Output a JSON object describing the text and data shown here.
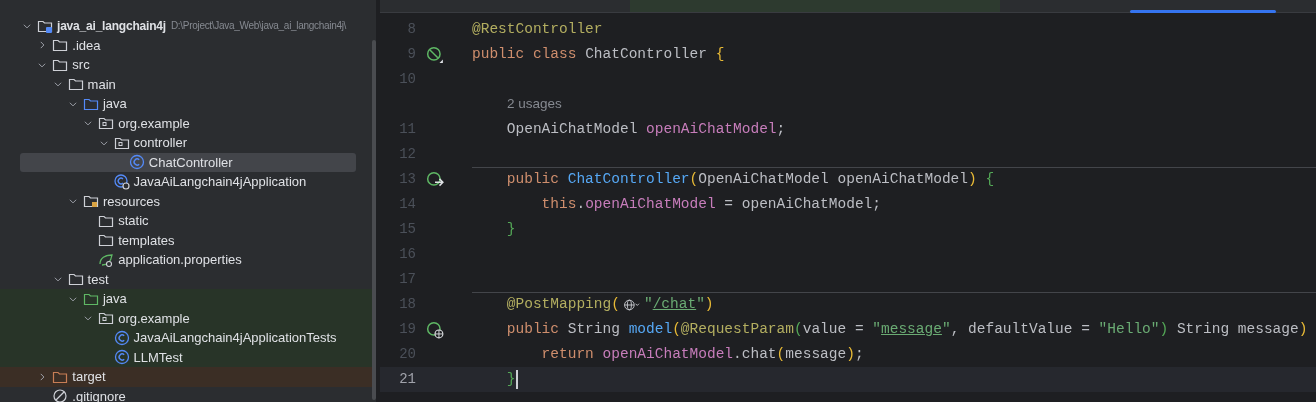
{
  "project_tree": {
    "items": [
      {
        "name": "java_ai_langchain4j",
        "path": "D:\\Project\\Java_Web\\java_ai_langchain4j\\",
        "kind": "module",
        "expanded": true,
        "selected": false,
        "children": [
          {
            "name": ".idea",
            "kind": "folder",
            "expanded": false,
            "selected": false
          },
          {
            "name": "src",
            "kind": "folder",
            "expanded": true,
            "selected": false,
            "children": [
              {
                "name": "main",
                "kind": "folder",
                "expanded": true,
                "selected": false,
                "children": [
                  {
                    "name": "java",
                    "kind": "source",
                    "expanded": true,
                    "selected": false,
                    "children": [
                      {
                        "name": "org.example",
                        "kind": "package",
                        "expanded": true,
                        "selected": false,
                        "children": [
                          {
                            "name": "controller",
                            "kind": "package",
                            "expanded": true,
                            "selected": false,
                            "children": [
                              {
                                "name": "ChatController",
                                "kind": "class",
                                "selected": true
                              }
                            ]
                          },
                          {
                            "name": "JavaAiLangchain4jApplication",
                            "kind": "spring-app",
                            "selected": false
                          }
                        ]
                      }
                    ]
                  },
                  {
                    "name": "resources",
                    "kind": "resources",
                    "expanded": true,
                    "selected": false,
                    "children": [
                      {
                        "name": "static",
                        "kind": "folder",
                        "selected": false
                      },
                      {
                        "name": "templates",
                        "kind": "folder",
                        "selected": false
                      },
                      {
                        "name": "application.properties",
                        "kind": "spring-config",
                        "selected": false
                      }
                    ]
                  }
                ]
              },
              {
                "name": "test",
                "kind": "folder",
                "expanded": true,
                "selected": false,
                "children": [
                  {
                    "name": "java",
                    "kind": "test-source",
                    "scope": {
                      "kind": "test"
                    },
                    "expanded": true,
                    "selected": false,
                    "children": [
                      {
                        "name": "org.example",
                        "kind": "package",
                        "scope": {
                          "kind": "test"
                        },
                        "expanded": true,
                        "selected": false,
                        "children": [
                          {
                            "name": "JavaAiLangchain4jApplicationTests",
                            "kind": "class",
                            "scope": {
                              "kind": "test"
                            },
                            "selected": false
                          },
                          {
                            "name": "LLMTest",
                            "kind": "class",
                            "scope": {
                              "kind": "test"
                            },
                            "selected": false
                          }
                        ]
                      }
                    ]
                  }
                ]
              }
            ]
          },
          {
            "name": "target",
            "kind": "excluded",
            "scope": {
              "kind": "excluded"
            },
            "expanded": false,
            "selected": false
          },
          {
            "name": ".gitignore",
            "kind": "ignore",
            "selected": false
          }
        ]
      }
    ]
  },
  "editor": {
    "lines": [
      {
        "number": "8",
        "current": false,
        "separator_above": false,
        "tokens": [
          {
            "kind": "ann",
            "text": "@RestController"
          }
        ]
      },
      {
        "number": "9",
        "current": false,
        "separator_above": false,
        "gutter": {
          "kind": "bean"
        },
        "tokens": [
          {
            "kind": "kw",
            "text": "public class "
          },
          {
            "kind": "plain",
            "text": "ChatController "
          },
          {
            "kind": "br1",
            "text": "{"
          }
        ]
      },
      {
        "number": "10",
        "current": false,
        "separator_above": false
      },
      {
        "number": "11",
        "current": false,
        "separator_above": false,
        "hint": "2 usages",
        "tokens": [
          {
            "kind": "plain",
            "text": "    OpenAiChatModel "
          },
          {
            "kind": "field",
            "text": "openAiChatModel"
          },
          {
            "kind": "plain",
            "text": ";"
          }
        ]
      },
      {
        "number": "12",
        "current": false,
        "separator_above": false
      },
      {
        "number": "13",
        "current": false,
        "separator_above": true,
        "gutter": {
          "kind": "bean-injection"
        },
        "tokens": [
          {
            "kind": "kw",
            "text": "    public "
          },
          {
            "kind": "method",
            "text": "ChatController"
          },
          {
            "kind": "br1",
            "text": "("
          },
          {
            "kind": "plain",
            "text": "OpenAiChatModel openAiChatModel"
          },
          {
            "kind": "br1",
            "text": ")"
          },
          {
            "kind": "br2",
            "text": " {"
          }
        ]
      },
      {
        "number": "14",
        "current": false,
        "separator_above": false,
        "tokens": [
          {
            "kind": "kw",
            "text": "        this"
          },
          {
            "kind": "plain",
            "text": "."
          },
          {
            "kind": "field",
            "text": "openAiChatModel"
          },
          {
            "kind": "plain",
            "text": " = openAiChatModel;"
          }
        ]
      },
      {
        "number": "15",
        "current": false,
        "separator_above": false,
        "tokens": [
          {
            "kind": "br2",
            "text": "    }"
          }
        ]
      },
      {
        "number": "16",
        "current": false,
        "separator_above": false
      },
      {
        "number": "17",
        "current": false,
        "separator_above": false
      },
      {
        "number": "18",
        "current": false,
        "separator_above": true,
        "tokens": [
          {
            "kind": "ann",
            "text": "    @PostMapping"
          },
          {
            "kind": "br1",
            "text": "("
          },
          {
            "kind": "inlay"
          },
          {
            "kind": "str",
            "text": "\""
          },
          {
            "kind": "link",
            "text": "/chat"
          },
          {
            "kind": "str",
            "text": "\""
          },
          {
            "kind": "br1",
            "text": ")"
          }
        ]
      },
      {
        "number": "19",
        "current": false,
        "separator_above": false,
        "gutter": {
          "kind": "endpoint"
        },
        "tokens": [
          {
            "kind": "kw",
            "text": "    public "
          },
          {
            "kind": "plain",
            "text": "String "
          },
          {
            "kind": "method",
            "text": "model"
          },
          {
            "kind": "br1",
            "text": "("
          },
          {
            "kind": "ann",
            "text": "@RequestParam"
          },
          {
            "kind": "br2",
            "text": "("
          },
          {
            "kind": "plain",
            "text": "value = "
          },
          {
            "kind": "str",
            "text": "\""
          },
          {
            "kind": "link",
            "text": "message"
          },
          {
            "kind": "str",
            "text": "\""
          },
          {
            "kind": "plain",
            "text": ", defaultValue = "
          },
          {
            "kind": "str",
            "text": "\"Hello\""
          },
          {
            "kind": "br2",
            "text": ")"
          },
          {
            "kind": "plain",
            "text": " String message"
          },
          {
            "kind": "br1",
            "text": ")"
          }
        ]
      },
      {
        "number": "20",
        "current": false,
        "separator_above": false,
        "tokens": [
          {
            "kind": "kw",
            "text": "        return "
          },
          {
            "kind": "field",
            "text": "openAiChatModel"
          },
          {
            "kind": "plain",
            "text": ".chat"
          },
          {
            "kind": "br1",
            "text": "("
          },
          {
            "kind": "plain",
            "text": "message"
          },
          {
            "kind": "br1",
            "text": ")"
          },
          {
            "kind": "plain",
            "text": ";"
          }
        ]
      },
      {
        "number": "21",
        "current": true,
        "separator_above": false,
        "tokens": [
          {
            "kind": "br2",
            "text": "    }"
          }
        ]
      }
    ]
  }
}
